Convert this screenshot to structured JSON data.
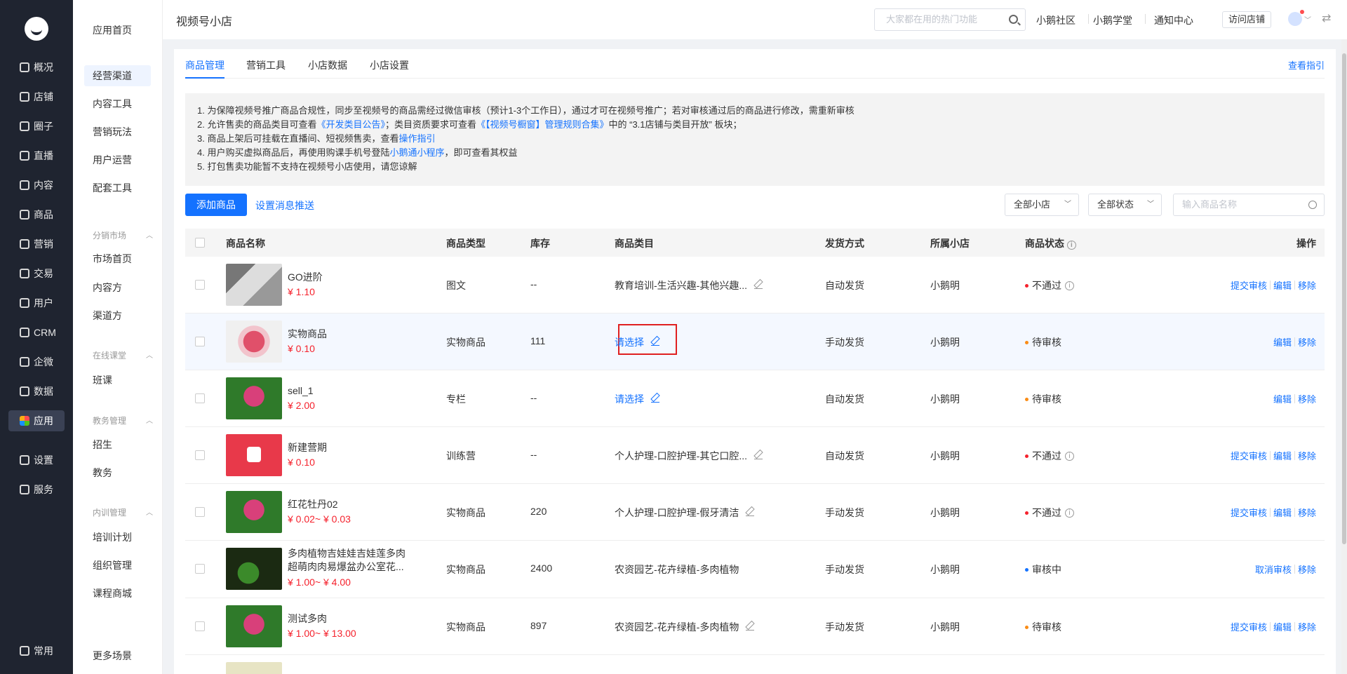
{
  "leftnav": {
    "items": [
      {
        "label": "概况",
        "icon": "overview-icon"
      },
      {
        "label": "店铺",
        "icon": "store-icon"
      },
      {
        "label": "圈子",
        "icon": "circle-icon"
      },
      {
        "label": "直播",
        "icon": "live-icon"
      },
      {
        "label": "内容",
        "icon": "content-icon"
      },
      {
        "label": "商品",
        "icon": "goods-icon"
      },
      {
        "label": "营销",
        "icon": "marketing-icon"
      },
      {
        "label": "交易",
        "icon": "trade-icon"
      },
      {
        "label": "用户",
        "icon": "user-icon"
      },
      {
        "label": "CRM",
        "icon": "crm-icon"
      },
      {
        "label": "企微",
        "icon": "wecom-icon"
      },
      {
        "label": "数据",
        "icon": "data-icon"
      },
      {
        "label": "应用",
        "icon": "apps-icon"
      },
      {
        "label": "设置",
        "icon": "settings-icon"
      },
      {
        "label": "服务",
        "icon": "service-icon"
      }
    ],
    "bottom": {
      "label": "常用",
      "icon": "frequent-icon"
    }
  },
  "subnav": {
    "home": "应用首页",
    "items": [
      "经营渠道",
      "内容工具",
      "营销玩法",
      "用户运营",
      "配套工具"
    ],
    "groups": [
      {
        "title": "分销市场",
        "items": [
          "市场首页",
          "内容方",
          "渠道方"
        ]
      },
      {
        "title": "在线课堂",
        "items": [
          "班课"
        ]
      },
      {
        "title": "教务管理",
        "items": [
          "招生",
          "教务"
        ]
      },
      {
        "title": "内训管理",
        "items": [
          "培训计划",
          "组织管理",
          "课程商城"
        ]
      }
    ],
    "more": "更多场景"
  },
  "topbar": {
    "title": "视频号小店",
    "search_placeholder": "大家都在用的热门功能",
    "links": [
      "小鹅社区",
      "小鹅学堂",
      "通知中心"
    ],
    "visit": "访问店铺"
  },
  "tabs": {
    "items": [
      "商品管理",
      "营销工具",
      "小店数据",
      "小店设置"
    ],
    "guide": "查看指引"
  },
  "notice": {
    "l1": "1. 为保障视频号推广商品合规性，同步至视频号的商品需经过微信审核（预计1-3个工作日），通过才可在视频号推广；若对审核通过后的商品进行修改，需重新审核",
    "l2a": "2. 允许售卖的商品类目可查看",
    "l2b": "《开发类目公告》",
    "l2c": "；类目资质要求可查看",
    "l2d": "《【视频号橱窗】管理规则合集》",
    "l2e": "中的 “3.1店铺与类目开放” 板块；",
    "l3a": "3. 商品上架后可挂载在直播间、短视频售卖，查看",
    "l3b": "操作指引",
    "l4a": "4. 用户购买虚拟商品后，再使用购课手机号登陆",
    "l4b": "小鹅通小程序",
    "l4c": "，即可查看其权益",
    "l5": "5. 打包售卖功能暂不支持在视频号小店使用，请您谅解"
  },
  "actions": {
    "add": "添加商品",
    "push": "设置消息推送",
    "store_filter": "全部小店",
    "status_filter": "全部状态",
    "name_placeholder": "输入商品名称"
  },
  "table": {
    "headers": [
      "商品名称",
      "商品类型",
      "库存",
      "商品类目",
      "发货方式",
      "所属小店",
      "商品状态",
      "操作"
    ],
    "rows": [
      {
        "name": "GO进阶",
        "price": "¥ 1.10",
        "type": "图文",
        "stock": "--",
        "category": "教育培训-生活兴趣-其他兴趣...",
        "ship": "自动发货",
        "store": "小鹅明",
        "status": "不通过",
        "status_color": "red",
        "ops": [
          "提交审核",
          "编辑",
          "移除"
        ]
      },
      {
        "name": "实物商品",
        "price": "¥ 0.10",
        "type": "实物商品",
        "stock": "111",
        "category": "请选择",
        "ship": "手动发货",
        "store": "小鹅明",
        "status": "待审核",
        "status_color": "orange",
        "ops": [
          "编辑",
          "移除"
        ]
      },
      {
        "name": "sell_1",
        "price": "¥ 2.00",
        "type": "专栏",
        "stock": "--",
        "category": "请选择",
        "ship": "自动发货",
        "store": "小鹅明",
        "status": "待审核",
        "status_color": "orange",
        "ops": [
          "编辑",
          "移除"
        ]
      },
      {
        "name": "新建营期",
        "price": "¥ 0.10",
        "type": "训练营",
        "stock": "--",
        "category": "个人护理-口腔护理-其它口腔...",
        "ship": "自动发货",
        "store": "小鹅明",
        "status": "不通过",
        "status_color": "red",
        "ops": [
          "提交审核",
          "编辑",
          "移除"
        ]
      },
      {
        "name": "红花牡丹02",
        "price": "¥ 0.02~ ¥ 0.03",
        "type": "实物商品",
        "stock": "220",
        "category": "个人护理-口腔护理-假牙清洁",
        "ship": "手动发货",
        "store": "小鹅明",
        "status": "不通过",
        "status_color": "red",
        "ops": [
          "提交审核",
          "编辑",
          "移除"
        ]
      },
      {
        "name": "多肉植物吉娃娃吉娃莲多肉超萌肉肉易爆盆办公室花...",
        "price": "¥ 1.00~ ¥ 4.00",
        "type": "实物商品",
        "stock": "2400",
        "category": "农资园艺-花卉绿植-多肉植物",
        "ship": "手动发货",
        "store": "小鹅明",
        "status": "审核中",
        "status_color": "blue",
        "ops": [
          "取消审核",
          "移除"
        ]
      },
      {
        "name": "测试多肉",
        "price": "¥ 1.00~ ¥ 13.00",
        "type": "实物商品",
        "stock": "897",
        "category": "农资园艺-花卉绿植-多肉植物",
        "ship": "手动发货",
        "store": "小鹅明",
        "status": "待审核",
        "status_color": "orange",
        "ops": [
          "提交审核",
          "编辑",
          "移除"
        ]
      }
    ]
  }
}
